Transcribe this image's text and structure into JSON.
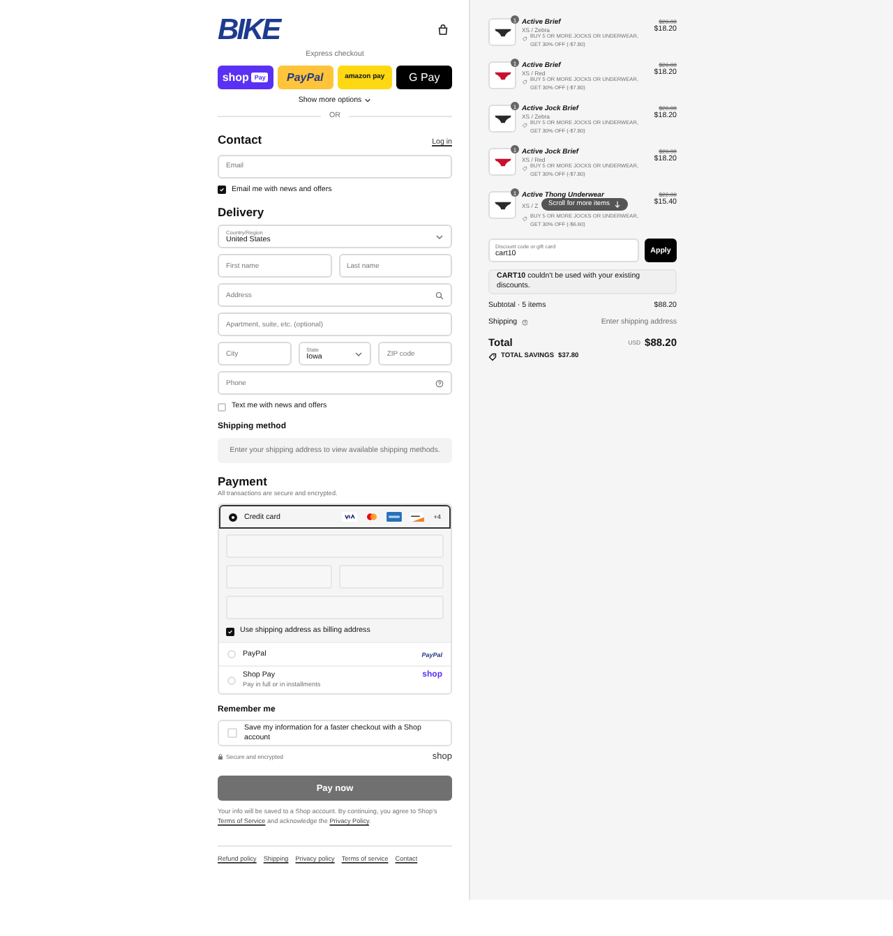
{
  "header": {
    "logo": "BIKE"
  },
  "express": {
    "label": "Express checkout",
    "buttons": [
      {
        "kind": "shop",
        "text": "shop",
        "badge": "Pay"
      },
      {
        "kind": "paypal",
        "text": "PayPal"
      },
      {
        "kind": "amazon",
        "text": "amazon pay"
      },
      {
        "kind": "gpay",
        "text": "G Pay"
      }
    ],
    "more": "Show more options",
    "or": "OR"
  },
  "contact": {
    "title": "Contact",
    "login": "Log in",
    "email": {
      "placeholder": "Email"
    },
    "news": {
      "label": "Email me with news and offers",
      "checked": true
    }
  },
  "delivery": {
    "title": "Delivery",
    "rows": [
      [
        {
          "kind": "select",
          "label": "Country/Region",
          "value": "United States"
        }
      ],
      [
        {
          "kind": "text",
          "placeholder": "First name"
        },
        {
          "kind": "text",
          "placeholder": "Last name"
        }
      ],
      [
        {
          "kind": "search",
          "placeholder": "Address"
        }
      ],
      [
        {
          "kind": "text",
          "placeholder": "Apartment, suite, etc. (optional)"
        }
      ],
      [
        {
          "kind": "text",
          "placeholder": "City"
        },
        {
          "kind": "select",
          "label": "State",
          "value": "Iowa"
        },
        {
          "kind": "text",
          "placeholder": "ZIP code"
        }
      ],
      [
        {
          "kind": "help",
          "placeholder": "Phone"
        }
      ]
    ],
    "sms": {
      "label": "Text me with news and offers",
      "checked": false
    }
  },
  "shipping_method": {
    "title": "Shipping method",
    "note": "Enter your shipping address to view available shipping methods."
  },
  "payment": {
    "title": "Payment",
    "subtitle": "All transactions are secure and encrypted.",
    "methods": [
      {
        "kind": "card",
        "label": "Credit card",
        "selected": true,
        "more": "+4"
      },
      {
        "kind": "paypal",
        "label": "PayPal",
        "selected": false,
        "logo": "PayPal"
      },
      {
        "kind": "shop",
        "label": "Shop Pay",
        "sublabel": "Pay in full or in installments",
        "selected": false,
        "logo": "shop"
      }
    ],
    "billing": {
      "label": "Use shipping address as billing address",
      "checked": true
    }
  },
  "remember": {
    "title": "Remember me",
    "save": {
      "label": "Save my information for a faster checkout with a Shop account",
      "checked": false
    },
    "secure": "Secure and encrypted",
    "logo": "shop"
  },
  "pay_button": "Pay now",
  "legal": [
    {
      "text": "Your info will be saved to a Shop account. By continuing, you agree to Shop's "
    },
    {
      "text": "Terms of Service",
      "link": true
    },
    {
      "text": " and acknowledge the "
    },
    {
      "text": "Privacy Policy",
      "link": true
    },
    {
      "text": "."
    }
  ],
  "footer_links": [
    "Refund policy",
    "Shipping",
    "Privacy policy",
    "Terms of service",
    "Contact"
  ],
  "summary": {
    "items": [
      {
        "quantity": "1",
        "title": "Active Brief",
        "variant": "XS / Zebra",
        "discount": "BUY 5 OR MORE JOCKS OR UNDERWEAR, GET 30% OFF (-$7.80)",
        "original_price": "$26.00",
        "price": "$18.20",
        "color": "#2a2a2a"
      },
      {
        "quantity": "1",
        "title": "Active Brief",
        "variant": "XS / Red",
        "discount": "BUY 5 OR MORE JOCKS OR UNDERWEAR, GET 30% OFF (-$7.80)",
        "original_price": "$26.00",
        "price": "$18.20",
        "color": "#c8102e"
      },
      {
        "quantity": "1",
        "title": "Active Jock Brief",
        "variant": "XS / Zebra",
        "discount": "BUY 5 OR MORE JOCKS OR UNDERWEAR, GET 30% OFF (-$7.80)",
        "original_price": "$26.00",
        "price": "$18.20",
        "color": "#2a2a2a"
      },
      {
        "quantity": "1",
        "title": "Active Jock Brief",
        "variant": "XS / Red",
        "discount": "BUY 5 OR MORE JOCKS OR UNDERWEAR, GET 30% OFF (-$7.80)",
        "original_price": "$26.00",
        "price": "$18.20",
        "color": "#c8102e"
      },
      {
        "quantity": "1",
        "title": "Active Thong Underwear",
        "variant": "XS / Z",
        "discount": "BUY 5 OR MORE JOCKS OR UNDERWEAR, GET 30% OFF (-$6.60)",
        "original_price": "$22.00",
        "price": "$15.40",
        "color": "#2a2a2a"
      }
    ],
    "toast": "Scroll for more items",
    "discount": {
      "label": "Discount code or gift card",
      "value": "cart10",
      "button": "Apply"
    },
    "error": "**CART10** couldn't be used with your existing discounts.",
    "subtotal": {
      "label": "Subtotal · 5 items",
      "value": "$88.20"
    },
    "shipping": {
      "label": "Shipping",
      "value": "Enter shipping address"
    },
    "total": {
      "label": "Total",
      "currency": "USD",
      "value": "$88.20"
    },
    "savings": {
      "label": "TOTAL SAVINGS",
      "value": "$37.80"
    }
  }
}
